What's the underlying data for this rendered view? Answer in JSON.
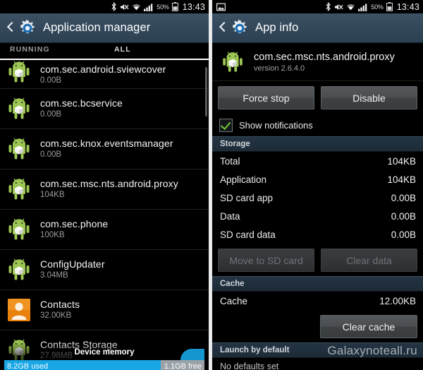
{
  "status_bar": {
    "left_icons": [
      "screenshot-icon"
    ],
    "icons": [
      "bluetooth-icon",
      "mute-icon",
      "wifi-icon",
      "signal-icon"
    ],
    "battery_percent": "50%",
    "time": "13:43"
  },
  "left_panel": {
    "title": "Application manager",
    "back_label": "Back",
    "tabs": [
      {
        "label": "RUNNING",
        "active": false
      },
      {
        "label": "ALL",
        "active": true
      }
    ],
    "apps": [
      {
        "name": "com.sec.android.sviewcover",
        "size": "0.00B",
        "icon": "android-package-icon",
        "clipped": true
      },
      {
        "name": "com.sec.bcservice",
        "size": "0.00B",
        "icon": "android-package-icon"
      },
      {
        "name": "com.sec.knox.eventsmanager",
        "size": "0.00B",
        "icon": "android-package-icon"
      },
      {
        "name": "com.sec.msc.nts.android.proxy",
        "size": "104KB",
        "icon": "android-package-icon"
      },
      {
        "name": "com.sec.phone",
        "size": "100KB",
        "icon": "android-package-icon"
      },
      {
        "name": "ConfigUpdater",
        "size": "3.04MB",
        "icon": "android-package-icon"
      },
      {
        "name": "Contacts",
        "size": "32.00KB",
        "icon": "contacts-icon"
      },
      {
        "name": "Contacts Storage",
        "size": "27.98MB",
        "icon": "android-package-icon"
      }
    ],
    "memory": {
      "title": "Device memory",
      "used": "8.2GB used",
      "free": "1.1GB free"
    }
  },
  "right_panel": {
    "title": "App info",
    "back_label": "Back",
    "app": {
      "name": "com.sec.msc.nts.android.proxy",
      "version": "version 2.6.4.0",
      "icon": "android-package-icon"
    },
    "actions": {
      "force_stop": "Force stop",
      "disable": "Disable"
    },
    "notifications": {
      "label": "Show notifications",
      "checked": true
    },
    "storage": {
      "section": "Storage",
      "rows": [
        {
          "key": "Total",
          "value": "104KB"
        },
        {
          "key": "Application",
          "value": "104KB"
        },
        {
          "key": "SD card app",
          "value": "0.00B"
        },
        {
          "key": "Data",
          "value": "0.00B"
        },
        {
          "key": "SD card data",
          "value": "0.00B"
        }
      ],
      "move_to_sd": "Move to SD card",
      "clear_data": "Clear data"
    },
    "cache": {
      "section": "Cache",
      "row": {
        "key": "Cache",
        "value": "12.00KB"
      },
      "clear_cache": "Clear cache"
    },
    "launch": {
      "section": "Launch by default",
      "text": "No defaults set"
    }
  },
  "watermark": "Galaxynoteall.ru",
  "colors": {
    "actionbar": "#33485a",
    "section_header": "#1d2b37",
    "accent_blue": "#18a6e5",
    "check_green": "#73c93a",
    "contacts_orange": "#e8820c"
  }
}
